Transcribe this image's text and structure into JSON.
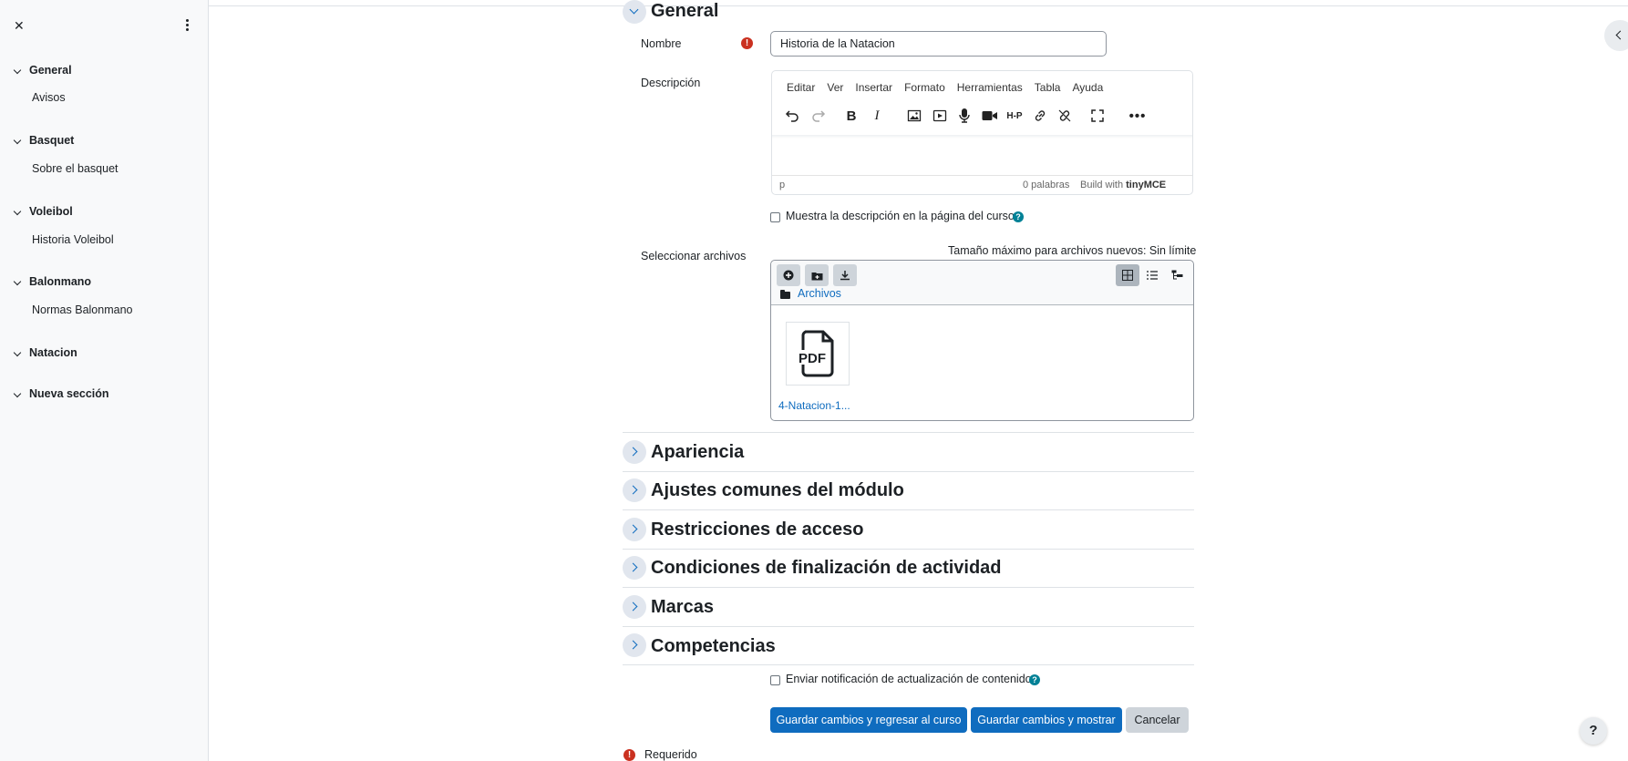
{
  "drawer": {
    "sections": [
      {
        "title": "General",
        "items": [
          "Avisos"
        ]
      },
      {
        "title": "Basquet",
        "items": [
          "Sobre el basquet"
        ]
      },
      {
        "title": "Voleibol",
        "items": [
          "Historia Voleibol"
        ]
      },
      {
        "title": "Balonmano",
        "items": [
          "Normas Balonmano"
        ]
      },
      {
        "title": "Natacion",
        "items": []
      },
      {
        "title": "Nueva sección",
        "items": []
      }
    ]
  },
  "form": {
    "general_header": "General",
    "name_label": "Nombre",
    "name_value": "Historia de la Natacion",
    "description_label": "Descripción",
    "editor": {
      "menu": [
        "Editar",
        "Ver",
        "Insertar",
        "Formato",
        "Herramientas",
        "Tabla",
        "Ayuda"
      ],
      "status_path": "p",
      "word_count": "0 palabras",
      "brand_prefix": "Build with",
      "brand_name": "tinyMCE"
    },
    "show_description_label": "Muestra la descripción en la página del curso",
    "select_files_label": "Seleccionar archivos",
    "max_size_text": "Tamaño máximo para archivos nuevos: Sin límite",
    "filemanager": {
      "path": "Archivos",
      "file_icon_text": "PDF",
      "file_name": "4-Natacion-1..."
    },
    "sections": [
      "Apariencia",
      "Ajustes comunes del módulo",
      "Restricciones de acceso",
      "Condiciones de finalización de actividad",
      "Marcas",
      "Competencias"
    ],
    "notify_label": "Enviar notificación de actualización de contenido",
    "buttons": {
      "save_return": "Guardar cambios y regresar al curso",
      "save_display": "Guardar cambios y mostrar",
      "cancel": "Cancelar"
    },
    "required_label": "Requerido",
    "required_icon": "!"
  },
  "help_fab": "?",
  "colors": {
    "primary": "#0f6cbf",
    "required": "#ca3120",
    "help": "#008196"
  }
}
